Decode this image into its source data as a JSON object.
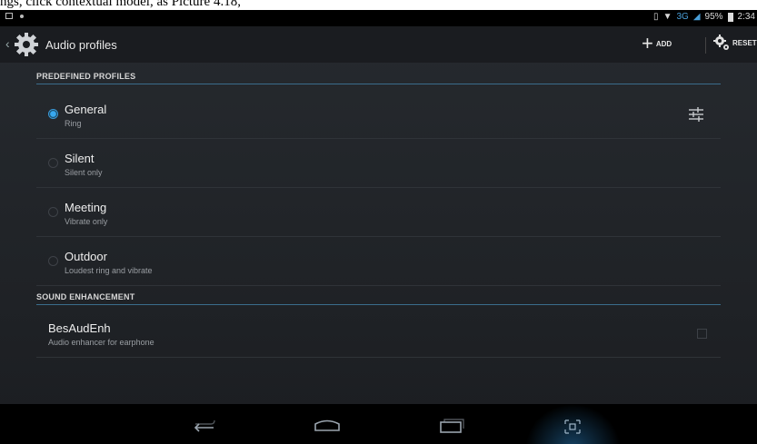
{
  "caption": "ngs, click contextual model, as Picture 4.18,",
  "status_bar": {
    "network": "3G",
    "battery": "95%",
    "time": "2:34"
  },
  "action_bar": {
    "title": "Audio profiles",
    "add_label": "ADD",
    "reset_label": "RESET"
  },
  "sections": {
    "predefined": "PREDEFINED PROFILES",
    "enhancement": "SOUND ENHANCEMENT"
  },
  "profiles": [
    {
      "title": "General",
      "subtitle": "Ring",
      "selected": true
    },
    {
      "title": "Silent",
      "subtitle": "Silent only",
      "selected": false
    },
    {
      "title": "Meeting",
      "subtitle": "Vibrate only",
      "selected": false
    },
    {
      "title": "Outdoor",
      "subtitle": "Loudest ring and vibrate",
      "selected": false
    }
  ],
  "enhancer": {
    "title": "BesAudEnh",
    "subtitle": "Audio enhancer for earphone",
    "checked": false
  },
  "icons": {
    "settings": "gear-icon",
    "add": "plus-icon",
    "reset": "gear-reset-icon",
    "equalizer": "equalizer-icon",
    "back": "back-icon",
    "home": "home-icon",
    "recents": "recent-apps-icon",
    "screenshot": "screenshot-icon"
  },
  "colors": {
    "accent": "#38a8ef",
    "background": "#202327",
    "actionbar": "#1a1c20"
  }
}
